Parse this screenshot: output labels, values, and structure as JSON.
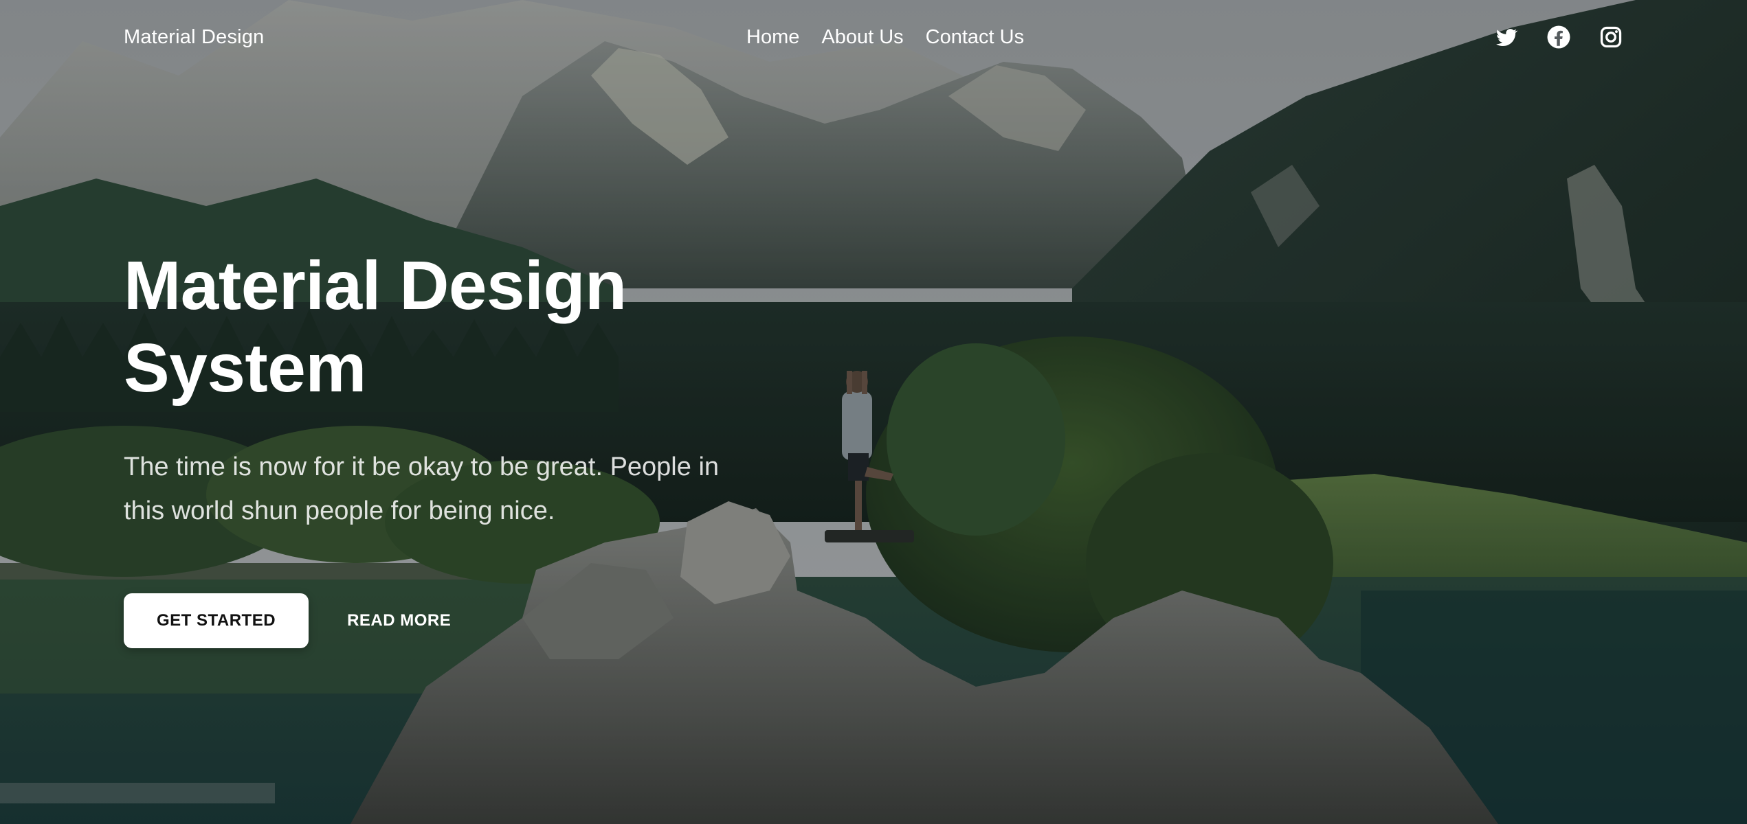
{
  "navbar": {
    "brand": "Material Design",
    "links": [
      {
        "label": "Home"
      },
      {
        "label": "About Us"
      },
      {
        "label": "Contact Us"
      }
    ],
    "socials": [
      "twitter-icon",
      "facebook-icon",
      "instagram-icon"
    ]
  },
  "hero": {
    "title": "Material Design System",
    "subtitle": "The time is now for it be okay to be great. People in this world shun people for being nice.",
    "primary_button": "GET STARTED",
    "secondary_button": "READ MORE"
  },
  "colors": {
    "text": "#ffffff",
    "button_bg": "#ffffff",
    "button_text": "#111111"
  }
}
